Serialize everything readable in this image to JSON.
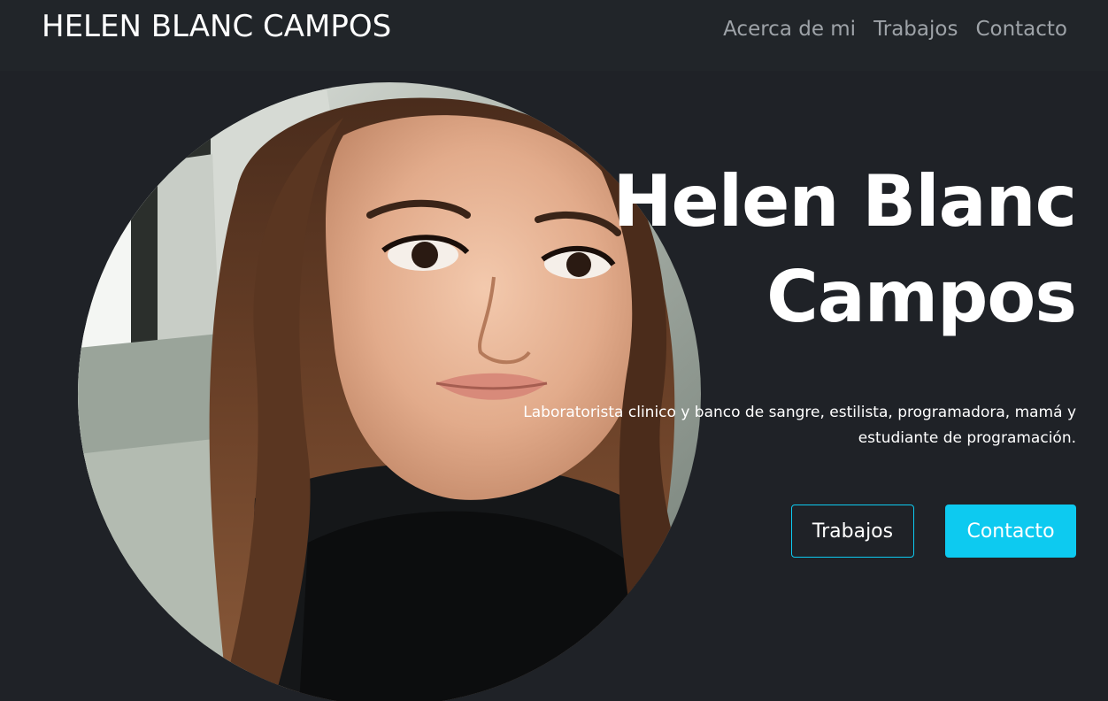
{
  "navbar": {
    "brand": "HELEN BLANC CAMPOS",
    "links": [
      "Acerca de mi",
      "Trabajos",
      "Contacto"
    ]
  },
  "hero": {
    "title_line1": "Helen Blanc",
    "title_line2": "Campos",
    "subtitle_line1": "Laboratorista clinico y banco de sangre, estilista, programadora, mamá y",
    "subtitle_line2": "estudiante de programación.",
    "buttons": {
      "secondary": "Trabajos",
      "primary": "Contacto"
    }
  },
  "colors": {
    "background": "#1f2227",
    "navbar": "#212529",
    "accent": "#0dcaf0",
    "nav_link": "#9ea3a8"
  }
}
